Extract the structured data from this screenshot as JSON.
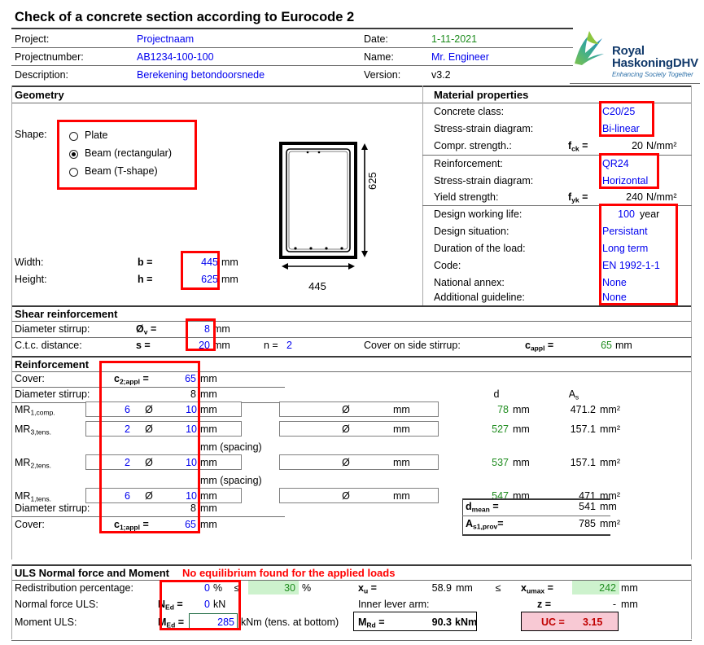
{
  "title": "Check of a concrete section according to Eurocode 2",
  "header": {
    "rows": [
      {
        "label": "Project:",
        "value": "Projectnaam",
        "label2": "Date:",
        "value2": "1-11-2021"
      },
      {
        "label": "Projectnumber:",
        "value": "AB1234-100-100",
        "label2": "Name:",
        "value2": "Mr. Engineer"
      },
      {
        "label": "Description:",
        "value": "Berekening betondoorsnede",
        "label2": "Version:",
        "value2": "v3.2"
      }
    ]
  },
  "logo": {
    "line1": "Royal",
    "line2": "HaskoningDHV",
    "tagline": "Enhancing Society Together"
  },
  "geometry": {
    "section_title": "Geometry",
    "shape_label": "Shape:",
    "options": [
      {
        "label": "Plate",
        "selected": false
      },
      {
        "label": "Beam (rectangular)",
        "selected": true
      },
      {
        "label": "Beam (T-shape)",
        "selected": false
      }
    ],
    "width_label": "Width:",
    "width_sym": "b =",
    "width_value": "445",
    "width_unit": "mm",
    "height_label": "Height:",
    "height_sym": "h =",
    "height_value": "625",
    "height_unit": "mm",
    "drawing": {
      "height_dim": "625",
      "width_dim": "445"
    }
  },
  "material": {
    "section_title": "Material properties",
    "concrete_class_label": "Concrete class:",
    "concrete_class_value": "C20/25",
    "concrete_ssd_label": "Stress-strain diagram:",
    "concrete_ssd_value": "Bi-linear",
    "fck_label": "Compr. strength.:",
    "fck_sym": "f",
    "fck_sub": "ck",
    "fck_eq": "=",
    "fck_value": "20",
    "fck_unit": "N/mm²",
    "reinf_label": "Reinforcement:",
    "reinf_value": "QR24",
    "reinf_ssd_label": "Stress-strain diagram:",
    "reinf_ssd_value": "Horizontal",
    "fyk_label": "Yield strength:",
    "fyk_sym": "f",
    "fyk_sub": "yk",
    "fyk_eq": "=",
    "fyk_value": "240",
    "fyk_unit": "N/mm²",
    "dwl_label": "Design working life:",
    "dwl_value": "100",
    "dwl_unit": "year",
    "dsit_label": "Design situation:",
    "dsit_value": "Persistant",
    "dur_label": "Duration of the load:",
    "dur_value": "Long term",
    "code_label": "Code:",
    "code_value": "EN 1992-1-1",
    "na_label": "National annex:",
    "na_value": "None",
    "guide_label": "Additional guideline:",
    "guide_value": "None"
  },
  "shear": {
    "section_title": "Shear reinforcement",
    "dia_label": "Diameter stirrup:",
    "dia_sym": "Ø",
    "dia_sub": "v",
    "dia_eq": "=",
    "dia_value": "8",
    "dia_unit": "mm",
    "ctc_label": "C.t.c. distance:",
    "ctc_sym": "s =",
    "ctc_value": "20",
    "ctc_unit": "mm",
    "n_label": "n =",
    "n_value": "2",
    "cover_side_label": "Cover on side stirrup:",
    "cover_side_sym": "c",
    "cover_side_sub": "appl",
    "cover_side_eq": "=",
    "cover_side_value": "65",
    "cover_side_unit": "mm"
  },
  "reinforcement": {
    "section_title": "Reinforcement",
    "col_d": "d",
    "col_as": "A",
    "col_as_sub": "s",
    "dia_sym": "Ø",
    "mm": "mm",
    "mm2": "mm²",
    "spacing_note": "mm (spacing)",
    "rows": [
      {
        "type": "cover",
        "label": "Cover:",
        "sym": "c",
        "sub": "2;appl",
        "eq": "=",
        "value": "65",
        "unit": "mm"
      },
      {
        "type": "stirrup",
        "label": "Diameter stirrup:",
        "value": "8",
        "unit": "mm"
      },
      {
        "type": "bar",
        "label": "MR",
        "sub": "1,comp.",
        "count": "6",
        "dia": "10",
        "unit": "mm",
        "d": "78",
        "d_unit": "mm",
        "as": "471.2",
        "as_unit": "mm²"
      },
      {
        "type": "bar",
        "label": "MR",
        "sub": "3,tens.",
        "count": "2",
        "dia": "10",
        "unit": "mm",
        "d": "527",
        "d_unit": "mm",
        "as": "157.1",
        "as_unit": "mm²"
      },
      {
        "type": "spacing",
        "note": "mm (spacing)"
      },
      {
        "type": "bar",
        "label": "MR",
        "sub": "2,tens.",
        "count": "2",
        "dia": "10",
        "unit": "mm",
        "d": "537",
        "d_unit": "mm",
        "as": "157.1",
        "as_unit": "mm²"
      },
      {
        "type": "spacing",
        "note": "mm (spacing)"
      },
      {
        "type": "bar",
        "label": "MR",
        "sub": "1,tens.",
        "count": "6",
        "dia": "10",
        "unit": "mm",
        "d": "547",
        "d_unit": "mm",
        "as": "471",
        "as_unit": "mm²"
      },
      {
        "type": "stirrup",
        "label": "Diameter stirrup:",
        "value": "8",
        "unit": "mm"
      },
      {
        "type": "cover",
        "label": "Cover:",
        "sym": "c",
        "sub": "1;appl",
        "eq": "=",
        "value": "65",
        "unit": "mm"
      }
    ],
    "dmean_sym": "d",
    "dmean_sub": "mean",
    "dmean_eq": "=",
    "dmean_value": "541",
    "dmean_unit": "mm",
    "asprov_sym": "A",
    "asprov_sub": "s1,prov",
    "asprov_eq": "=",
    "asprov_value": "785",
    "asprov_unit": "mm²"
  },
  "uls": {
    "section_title": "ULS Normal force and Moment",
    "warning": "No equilibrium found for the applied loads",
    "redist_label": "Redistribution percentage:",
    "redist_value": "0",
    "redist_unit": "%",
    "le": "≤",
    "redist_max": "30",
    "redist_max_unit": "%",
    "xu_sym": "x",
    "xu_sub": "u",
    "xu_eq": "=",
    "xu_value": "58.9",
    "xu_unit": "mm",
    "xumax_sym": "x",
    "xumax_sub": "umax",
    "xumax_eq": "=",
    "xumax_value": "242",
    "xumax_unit": "mm",
    "ned_label": "Normal force ULS:",
    "ned_sym": "N",
    "ned_sub": "Ed",
    "ned_eq": "=",
    "ned_value": "0",
    "ned_unit": "kN",
    "lever_label": "Inner lever arm:",
    "z_sym": "z =",
    "z_value": "-",
    "z_unit": "mm",
    "med_label": "Moment ULS:",
    "med_sym": "M",
    "med_sub": "Ed",
    "med_eq": "=",
    "med_value": "285",
    "med_unit": "kNm (tens. at bottom)",
    "mrd_sym": "M",
    "mrd_sub": "Rd",
    "mrd_eq": "=",
    "mrd_value": "90.3",
    "mrd_unit": "kNm",
    "uc_label": "UC =",
    "uc_value": "3.15"
  }
}
